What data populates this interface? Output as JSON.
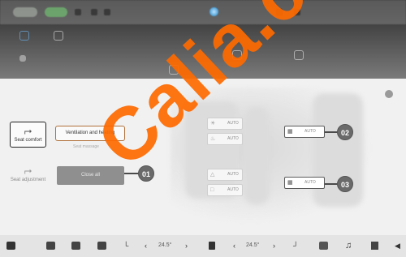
{
  "nav": {
    "seat_comfort": "Seat comfort",
    "seat_adjustment": "Seat adjustment"
  },
  "panel": {
    "tab_vent_heat": "Ventilation and heating",
    "sub_label": "Seat massage",
    "close_all": "Close all"
  },
  "controls": {
    "auto": "AUTO"
  },
  "callouts": [
    "01",
    "02",
    "03"
  ],
  "dock": {
    "temp_left": "24.5°",
    "temp_right": "24.5°",
    "arrow_left": "‹",
    "arrow_right": "›"
  },
  "watermark": "Calia.co",
  "colors": {
    "watermark": "#ff6a00",
    "tab_border": "#b0703a",
    "callout": "#6a6a6a"
  }
}
